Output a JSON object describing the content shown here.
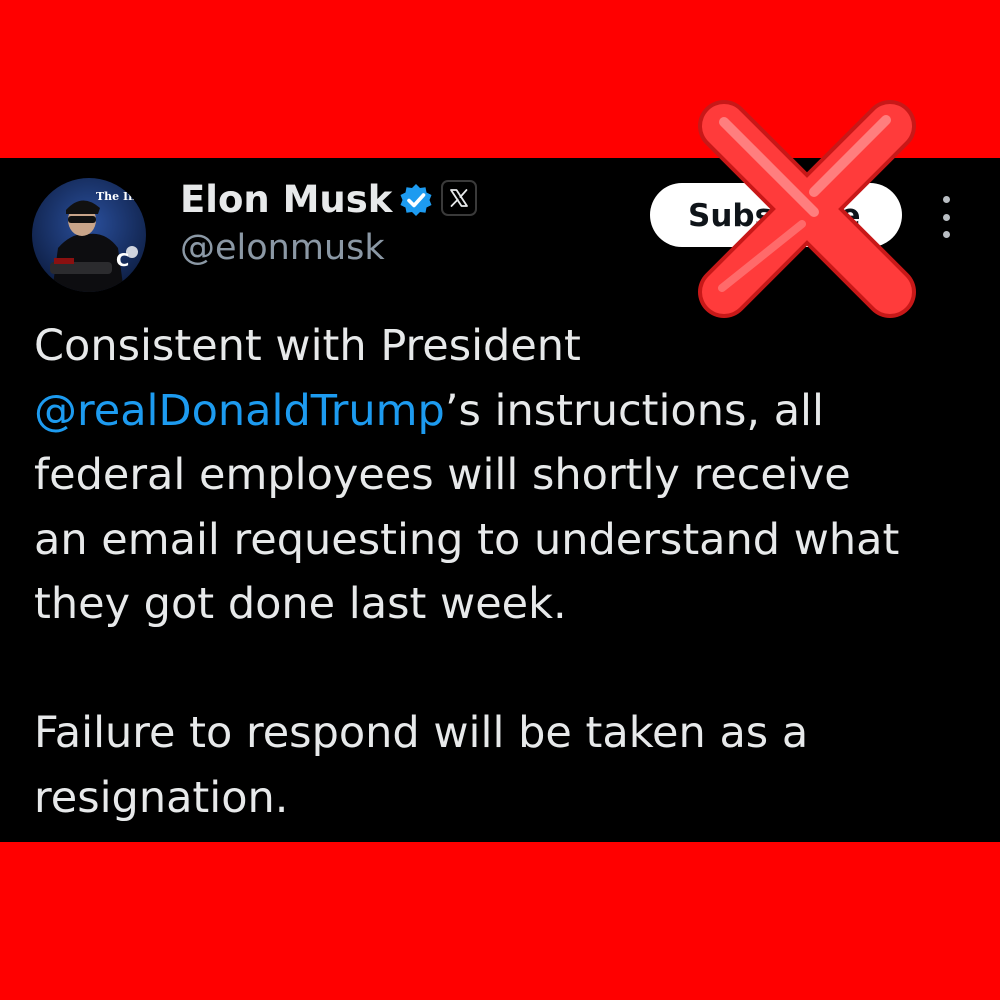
{
  "colors": {
    "frame": "#ff0000",
    "tweet_background": "#000000",
    "text_primary": "#e7e9ea",
    "text_secondary": "#8b98a5",
    "mention": "#1d9bf0",
    "verified_badge": "#1d9bf0",
    "subscribe_button": "#ffffff",
    "cross_mark": "#ff3b3b"
  },
  "author": {
    "display_name": "Elon Musk",
    "handle": "@elonmusk",
    "avatar_icon": "profile-photo",
    "avatar_caption": "The Imogefa",
    "verified_icon": "verified-badge-icon",
    "affiliation_icon": "x-logo-icon"
  },
  "actions": {
    "subscribe_label": "Subscribe",
    "more_icon": "more-options-icon"
  },
  "tweet": {
    "line1_a": "Consistent with President",
    "mention": "@realDonaldTrump",
    "line2_b": "’s instructions, all",
    "line3": "federal employees will shortly receive",
    "line4": "an email requesting to understand what",
    "line5": "they got done last week.",
    "line6": "Failure to respond will be taken as a",
    "line7": "resignation."
  },
  "overlay": {
    "icon": "red-x-icon"
  }
}
